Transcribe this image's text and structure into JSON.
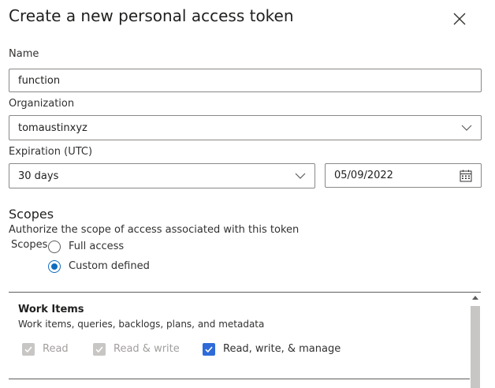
{
  "dialog": {
    "title": "Create a new personal access token"
  },
  "name": {
    "label": "Name",
    "value": "function"
  },
  "organization": {
    "label": "Organization",
    "value": "tomaustinxyz"
  },
  "expiration": {
    "label": "Expiration (UTC)",
    "duration": "30 days",
    "date": "05/09/2022"
  },
  "scopes": {
    "heading": "Scopes",
    "description": "Authorize the scope of access associated with this token",
    "group_label": "Scopes",
    "options": [
      {
        "label": "Full access",
        "selected": false
      },
      {
        "label": "Custom defined",
        "selected": true
      }
    ]
  },
  "work_items": {
    "title": "Work Items",
    "description": "Work items, queries, backlogs, plans, and metadata",
    "permissions": [
      {
        "label": "Read",
        "checked": true,
        "disabled": true
      },
      {
        "label": "Read & write",
        "checked": true,
        "disabled": true
      },
      {
        "label": "Read, write, & manage",
        "checked": true,
        "disabled": false
      }
    ]
  },
  "colors": {
    "accent": "#0f6cbd",
    "checkbox_active": "#2f6bd8",
    "border": "#8a8886",
    "disabled": "#c8c6c4"
  }
}
